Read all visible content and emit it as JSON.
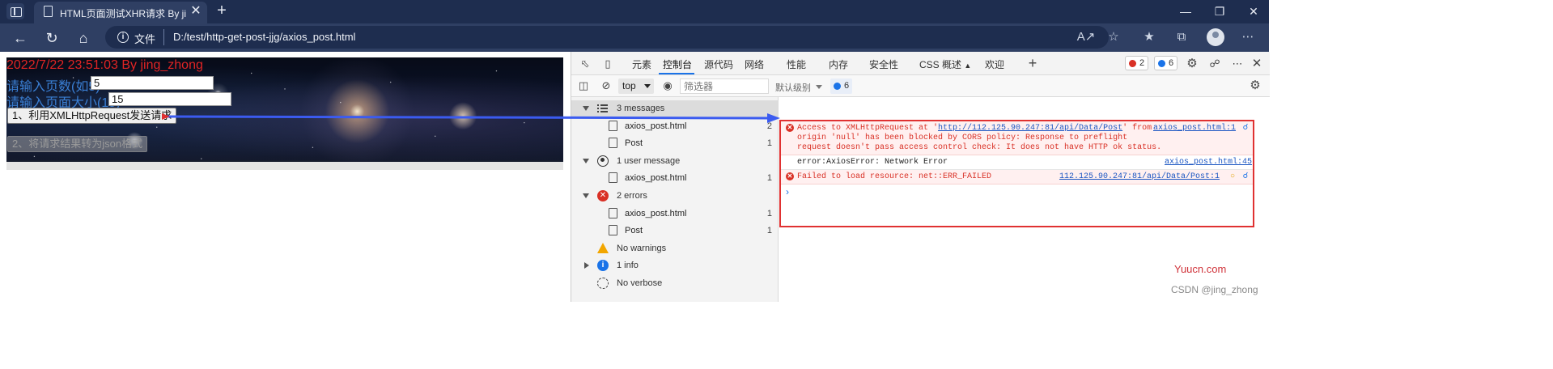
{
  "browser": {
    "tab_title": "HTML页面测试XHR请求 By jing_",
    "tab_close": "✕",
    "new_tab": "+",
    "file_label": "文件",
    "url": "D:/test/http-get-post-jjg/axios_post.html",
    "window_controls": [
      "—",
      "❐",
      "✕"
    ]
  },
  "page": {
    "datestamp": "2022/7/22 23:51:03 By jing_zhong",
    "page_no_label": "请输入页数(如5)",
    "page_no_value": "5",
    "page_size_label": "请输入页面大小(15)",
    "page_size_value": "15",
    "xhr_button": "1、利用XMLHttpRequest发送请求",
    "json_button": "2、将请求结果转为json格式"
  },
  "devtools": {
    "tabs": [
      "元素",
      "控制台",
      "源代码",
      "网络",
      "性能",
      "内存",
      "安全性",
      "CSS 概述",
      "欢迎"
    ],
    "active_tab": "控制台",
    "css_overview_flask": "▲",
    "error_count": "2",
    "message_count": "6",
    "context": "top",
    "filter_placeholder": "筛选器",
    "level": "默认级别",
    "issues_count": "6",
    "sidebar": [
      {
        "label": "3 messages",
        "kind": "group",
        "open": true
      },
      {
        "label": "axios_post.html",
        "kind": "file",
        "count": "2"
      },
      {
        "label": "Post",
        "kind": "file",
        "count": "1"
      },
      {
        "label": "1 user message",
        "kind": "group",
        "open": true
      },
      {
        "label": "axios_post.html",
        "kind": "file",
        "count": "1"
      },
      {
        "label": "2 errors",
        "kind": "group",
        "open": true
      },
      {
        "label": "axios_post.html",
        "kind": "file",
        "count": "1"
      },
      {
        "label": "Post",
        "kind": "file",
        "count": "1"
      },
      {
        "label": "No warnings",
        "kind": "group"
      },
      {
        "label": "1 info",
        "kind": "group",
        "open": false
      },
      {
        "label": "No verbose",
        "kind": "group"
      }
    ],
    "console": {
      "cors_error": {
        "line1_pre": "Access to XMLHttpRequest at '",
        "line1_link": "http://112.125.90.247:81/api/Data/Post",
        "line1_post": "' from",
        "line2": "origin 'null' has been blocked by CORS policy: Response to preflight",
        "line3": "request doesn't pass access control check: It does not have HTTP ok status.",
        "source": "axios_post.html:1"
      },
      "axios_error": {
        "text": "error:AxiosError: Network Error",
        "source": "axios_post.html:45"
      },
      "load_error": {
        "text": "Failed to load resource: net::ERR_FAILED",
        "source": "112.125.90.247:81/api/Data/Post:1"
      },
      "prompt": "›"
    }
  },
  "watermarks": {
    "yuucn": "Yuucn.com",
    "csdn": "CSDN @jing_zhong"
  },
  "colors": {
    "title_bar": "#1e2d4f",
    "address_bar": "#2f3f63",
    "datestamp": "#e02424",
    "form_label": "#3a7fd4",
    "error_red": "#d93025",
    "link_blue": "#1a55c2",
    "arrow_blue": "#3b5bf0",
    "highlight_box": "#e03131"
  }
}
